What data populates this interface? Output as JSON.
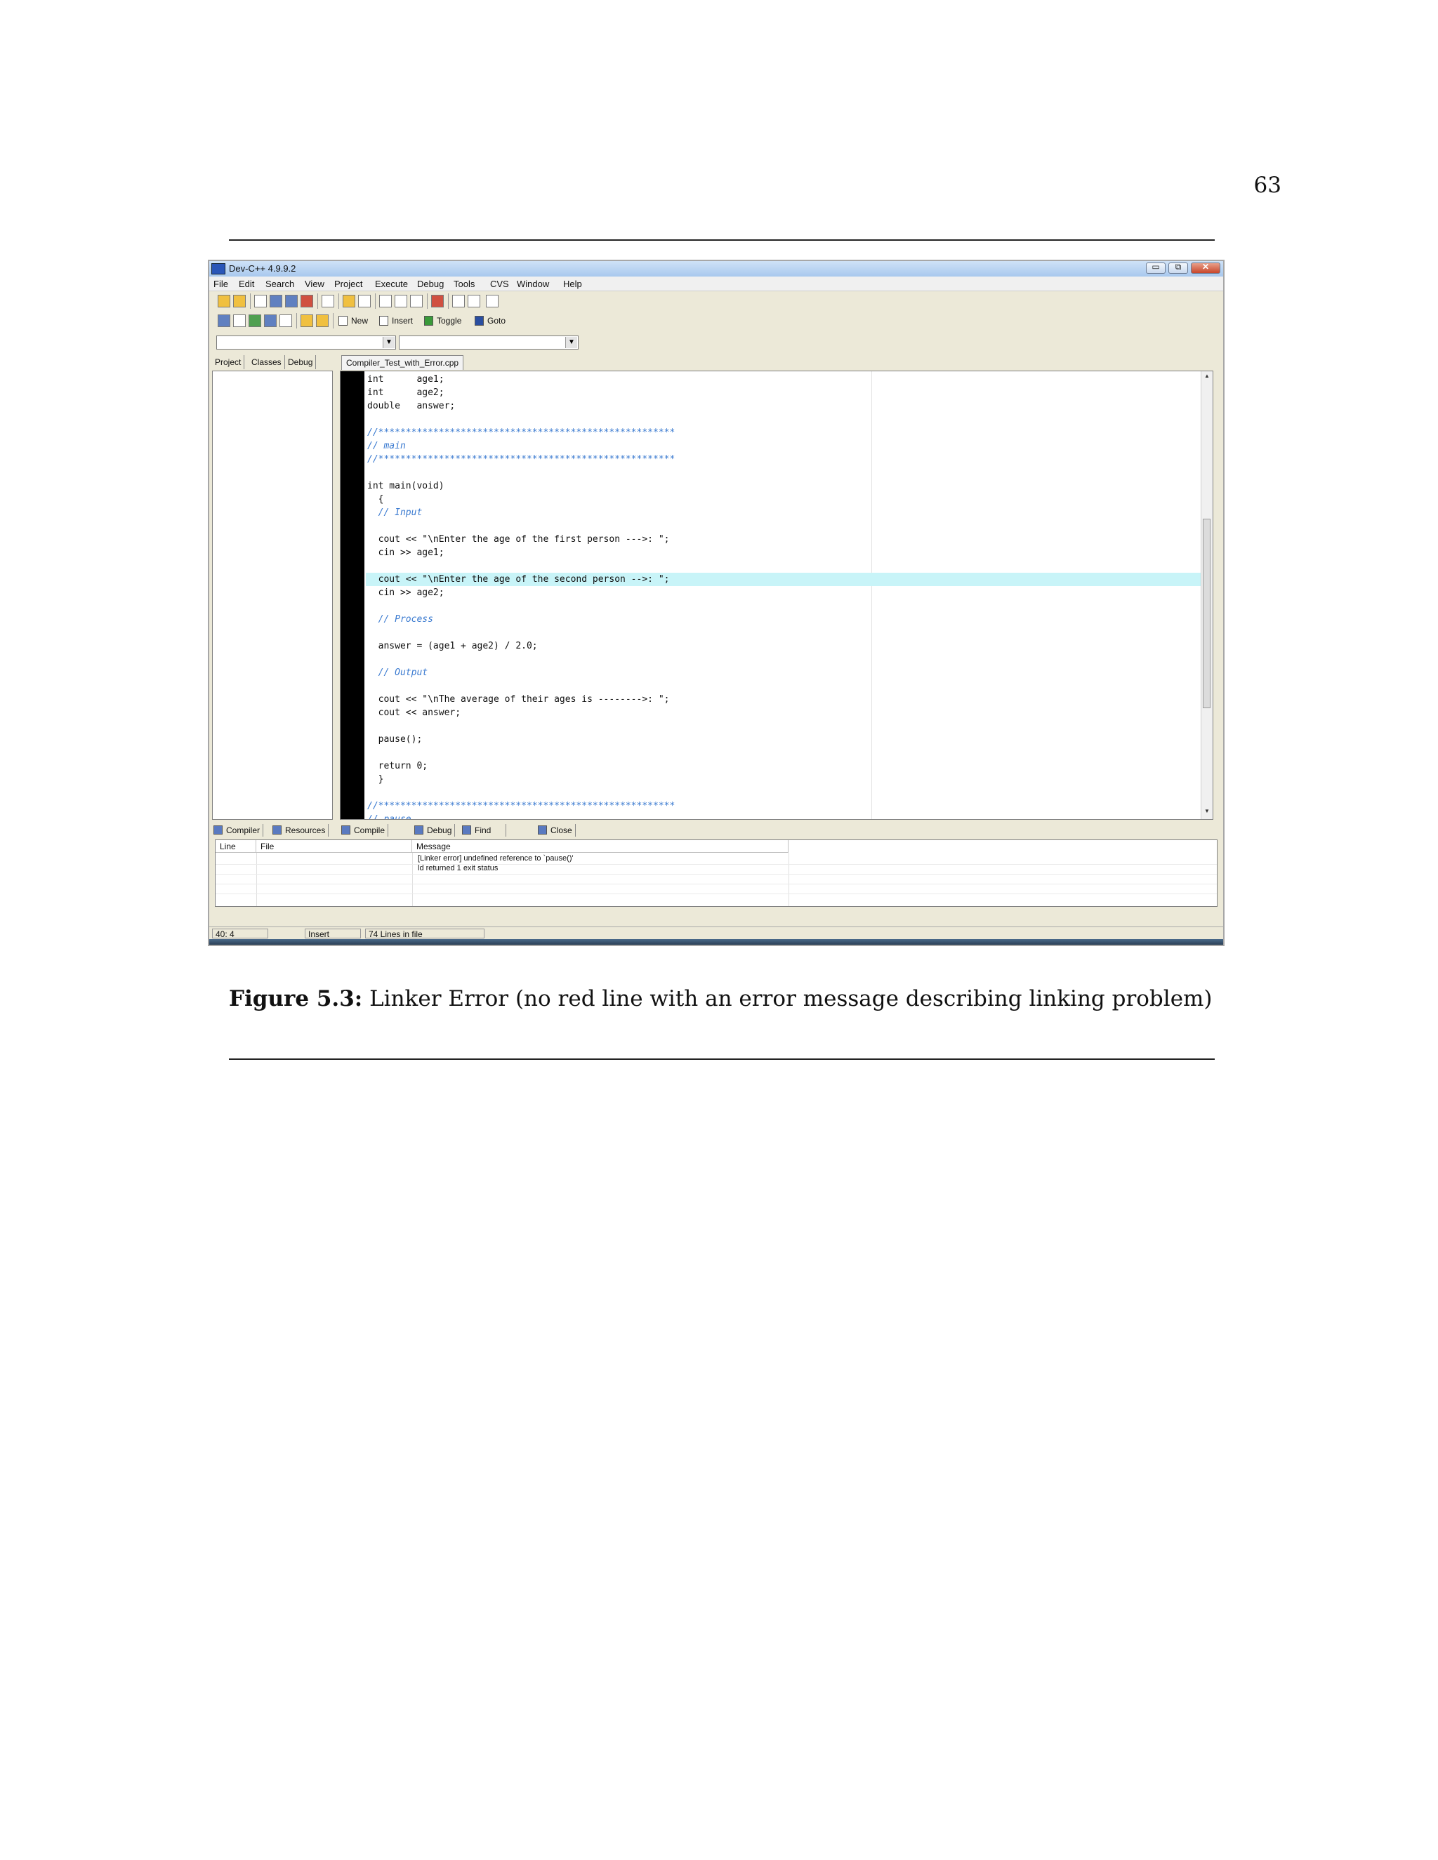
{
  "page": {
    "number": "63"
  },
  "window": {
    "title": "Dev-C++ 4.9.9.2",
    "menu": [
      "File",
      "Edit",
      "Search",
      "View",
      "Project",
      "Execute",
      "Debug",
      "Tools",
      "CVS",
      "Window",
      "Help"
    ],
    "toolbar": {
      "new_label": "New",
      "insert_label": "Insert",
      "toggle_label": "Toggle",
      "goto_label": "Goto"
    },
    "left_tabs": [
      "Project",
      "Classes",
      "Debug"
    ],
    "file_tab": "Compiler_Test_with_Error.cpp",
    "code_lines": [
      "int      age1;",
      "int      age2;",
      "double   answer;",
      "",
      "//******************************************************",
      "// main",
      "//******************************************************",
      "",
      "int main(void)",
      "  {",
      "  // Input",
      "",
      "  cout << \"\\nEnter the age of the first person --->: \";",
      "  cin >> age1;",
      "",
      "  cout << \"\\nEnter the age of the second person -->: \";",
      "  cin >> age2;",
      "",
      "  // Process",
      "",
      "  answer = (age1 + age2) / 2.0;",
      "",
      "  // Output",
      "",
      "  cout << \"\\nThe average of their ages is -------->: \";",
      "  cout << answer;",
      "",
      "  pause();",
      "",
      "  return 0;",
      "  }",
      "",
      "//******************************************************",
      "// pause"
    ],
    "bottom_tabs": [
      "Compiler",
      "Resources",
      "Compile Log",
      "Debug",
      "Find Results",
      "Close"
    ],
    "message_table": {
      "headers": [
        "Line",
        "File",
        "Message"
      ],
      "rows": [
        {
          "line": "",
          "file": "",
          "message": "[Linker error] undefined reference to `pause()'"
        },
        {
          "line": "",
          "file": "",
          "message": "ld returned 1 exit status"
        }
      ]
    },
    "status": {
      "position": "40: 4",
      "mode": "Insert",
      "lines": "74 Lines in file"
    }
  },
  "caption": {
    "label": "Figure 5.3:",
    "text": "Linker Error (no red line with an error message describing linking problem)"
  }
}
